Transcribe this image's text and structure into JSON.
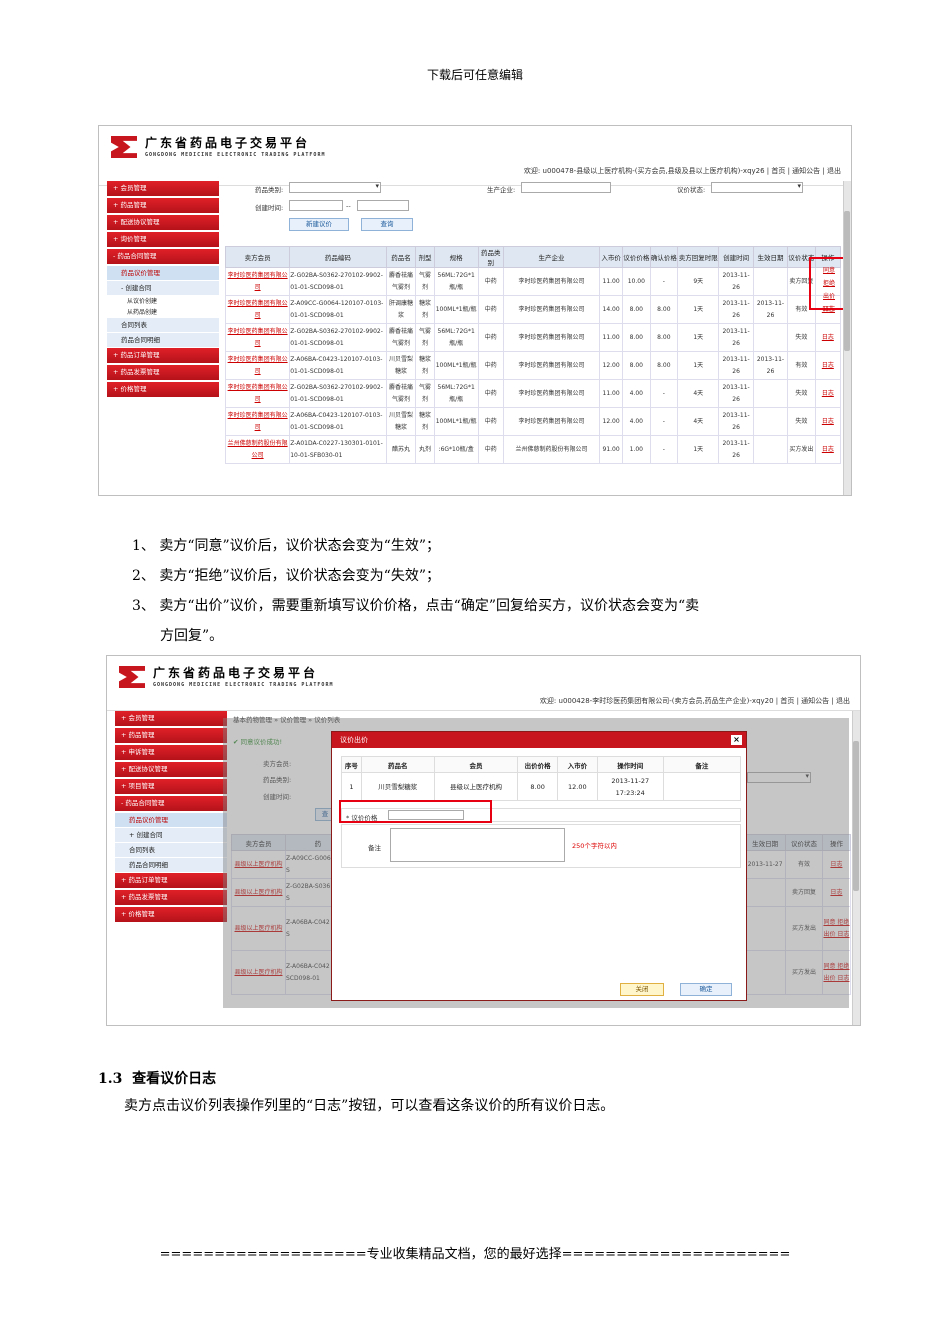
{
  "doc": {
    "header": "下载后可任意编辑",
    "steps": [
      "1、 卖方“同意”议价后，议价状态会变为“生效”；",
      "2、 卖方“拒绝”议价后，议价状态会变为“失效”；",
      "3、 卖方“出价”议价，需要重新填写议价价格，点击“确定”回复给买方，议价状态会变为“卖",
      "方回复”。"
    ],
    "section_number": "1.3",
    "section_title": "查看议价日志",
    "section_text": "卖方点击议价列表操作列里的“日志”按钮，可以查看这条议价的所有议价日志。",
    "footer": "===================专业收集精品文档，您的最好选择====================="
  },
  "platform": {
    "title_cn": "广东省药品电子交易平台",
    "title_en": "GONGDONG MEDICINE ELECTRONIC TRADING PLATFORM"
  },
  "shot1": {
    "welcome": "欢迎: u000478-县级以上医疗机构-(买方会员,县级及县以上医疗机构)-xqy26 | 首页 | 通知公告 | 退出",
    "nav": [
      "+ 会员管理",
      "+ 药品管理",
      "+ 配送协议管理",
      "+ 询价管理",
      "- 药品合同管理"
    ],
    "nav_sub": [
      "药品议价管理",
      "- 创建合同"
    ],
    "nav_plain": [
      "从议价创建",
      "从药品创建"
    ],
    "nav_sub2": [
      "合同列表",
      "药品合同明细"
    ],
    "nav_bottom": [
      "+ 药品订单管理",
      "+ 药品发票管理",
      "+ 价格管理"
    ],
    "filters": {
      "drug_type": "药品类别:",
      "create_time": "创建时间:",
      "dash": "--",
      "producer": "生产企业:",
      "status": "议价状态:",
      "new_btn": "新建议价",
      "query_btn": "查询"
    },
    "headers": [
      "卖方会员",
      "药品编码",
      "药品名",
      "剂型",
      "规格",
      "药品类别",
      "生产企业",
      "入市价",
      "议价价格",
      "确认价格",
      "卖方回复时限",
      "创建时间",
      "生效日期",
      "议价状态",
      "操作"
    ],
    "rows": [
      [
        "李时珍医药集团有限公司",
        "Z-G02BA-S0362-270102-9902-01-01-SCD098-01",
        "麝香祛痛气雾剂",
        "气雾剂",
        "56ML:72G*1瓶/瓶",
        "中药",
        "李时珍医药集团有限公司",
        "11.00",
        "10.00",
        "-",
        "9天",
        "2013-11-26",
        "",
        "卖方回复",
        ""
      ],
      [
        "李时珍医药集团有限公司",
        "Z-A09CC-G0064-120107-0103-01-01-SCD098-01",
        "肝调康糖浆",
        "糖浆剂",
        "100ML*1瓶/瓶",
        "中药",
        "李时珍医药集团有限公司",
        "14.00",
        "8.00",
        "8.00",
        "1天",
        "2013-11-26",
        "2013-11-26",
        "有效",
        "日志"
      ],
      [
        "李时珍医药集团有限公司",
        "Z-G02BA-S0362-270102-9902-01-01-SCD098-01",
        "麝香祛痛气雾剂",
        "气雾剂",
        "56ML:72G*1瓶/瓶",
        "中药",
        "李时珍医药集团有限公司",
        "11.00",
        "8.00",
        "8.00",
        "1天",
        "2013-11-26",
        "",
        "失效",
        "日志"
      ],
      [
        "李时珍医药集团有限公司",
        "Z-A06BA-C0423-120107-0103-01-01-SCD098-01",
        "川贝雪梨糖浆",
        "糖浆剂",
        "100ML*1瓶/瓶",
        "中药",
        "李时珍医药集团有限公司",
        "12.00",
        "8.00",
        "8.00",
        "1天",
        "2013-11-26",
        "2013-11-26",
        "有效",
        "日志"
      ],
      [
        "李时珍医药集团有限公司",
        "Z-G02BA-S0362-270102-9902-01-01-SCD098-01",
        "麝香祛痛气雾剂",
        "气雾剂",
        "56ML:72G*1瓶/瓶",
        "中药",
        "李时珍医药集团有限公司",
        "11.00",
        "4.00",
        "-",
        "4天",
        "2013-11-26",
        "",
        "失效",
        "日志"
      ],
      [
        "李时珍医药集团有限公司",
        "Z-A06BA-C0423-120107-0103-01-01-SCD098-01",
        "川贝雪梨糖浆",
        "糖浆剂",
        "100ML*1瓶/瓶",
        "中药",
        "李时珍医药集团有限公司",
        "12.00",
        "4.00",
        "-",
        "4天",
        "2013-11-26",
        "",
        "失效",
        "日志"
      ],
      [
        "兰州佛慈制药股份有限公司",
        "Z-A01DA-C0227-130301-0101-10-01-SFB030-01",
        "醋苏丸",
        "丸剂",
        ":6G*10瓶/盒",
        "中药",
        "兰州佛慈制药股份有限公司",
        "91.00",
        "1.00",
        "-",
        "1天",
        "2013-11-26",
        "",
        "买方发出",
        "日志"
      ]
    ],
    "row1_ops": [
      "同意",
      "拒绝",
      "出价",
      "日志"
    ]
  },
  "shot2": {
    "welcome": "欢迎: u000428-李时珍医药集团有限公司-(卖方会员,药品生产企业)-xqy20 | 首页 | 通知公告 | 退出",
    "breadcrumb": "基本药物管理 » 议价管理 » 议价列表",
    "success": "✔ 同意议价成功!",
    "nav": [
      "+ 会员管理",
      "+ 药品管理",
      "+ 申诉管理",
      "+ 配送协议管理",
      "+ 项目管理",
      "- 药品合同管理"
    ],
    "nav_sub": [
      "药品议价管理",
      "+ 创建合同",
      "合同列表",
      "药品合同明细"
    ],
    "nav_bottom": [
      "+ 药品订单管理",
      "+ 药品发票管理",
      "+ 价格管理"
    ],
    "bg_labels": [
      "卖方会员:",
      "药品类别:",
      "创建时间:"
    ],
    "bg_btn": "查",
    "bg_headers": [
      "卖方会员",
      "药"
    ],
    "bg_headers_right": [
      "生效日期",
      "议价状态",
      "操作"
    ],
    "bg_rows": [
      {
        "member": "县级以上医疗机构",
        "code": "Z-A09CC-G006 1-01-S",
        "date": "2013-11-27",
        "status": "有效",
        "ops": "日志"
      },
      {
        "member": "县级以上医疗机构",
        "code": "Z-G02BA-S036 1-01-S",
        "date": "",
        "status": "卖方回复",
        "ops": "日志"
      },
      {
        "member": "县级以上医疗机构",
        "code": "Z-A06BA-C042 1-01-S",
        "date": "",
        "status": "买方发出",
        "ops": "同意 拒绝 出价 日志"
      },
      {
        "member": "县级以上医疗机构",
        "code": "Z-A06BA-C042 1-01-SCD098-01",
        "date": "",
        "status": "买方发出",
        "ops": "同意 拒绝 出价 日志"
      }
    ],
    "dialog": {
      "title": "议价出价",
      "close": "×",
      "headers": [
        "序号",
        "药品名",
        "会员",
        "出价价格",
        "入市价",
        "操作时间",
        "备注"
      ],
      "row": [
        "1",
        "川贝雪梨糖浆",
        "县级以上医疗机构",
        "8.00",
        "12.00",
        "2013-11-27 17:23:24",
        ""
      ],
      "price_label": "* 议价价格",
      "remark_label": "备注",
      "remark_hint": "250个字符以内",
      "close_btn": "关闭",
      "ok_btn": "确定"
    }
  }
}
